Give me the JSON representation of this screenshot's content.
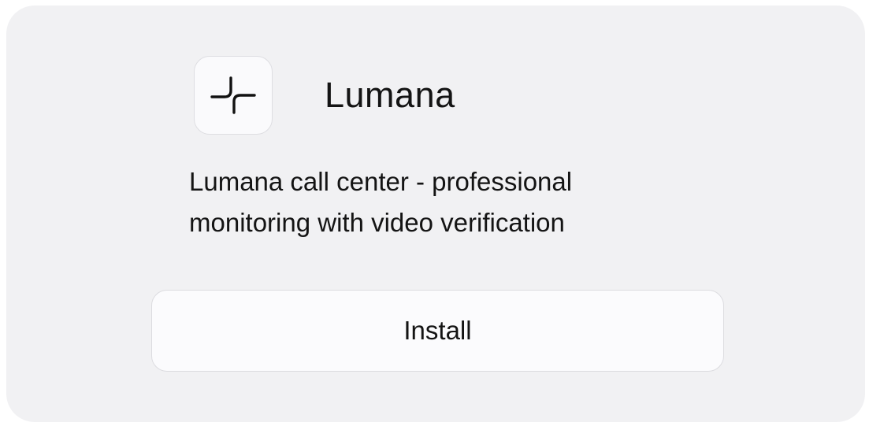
{
  "app": {
    "name": "Lumana",
    "icon": "lumana-spark-icon",
    "description_lines": [
      "Lumana call center - professional",
      "monitoring with video verification"
    ]
  },
  "actions": {
    "install_label": "Install"
  },
  "colors": {
    "card_background": "#f1f1f3",
    "icon_background": "#fafafc",
    "button_background": "#fbfbfd",
    "border": "#dcdce0",
    "text": "#141414"
  }
}
